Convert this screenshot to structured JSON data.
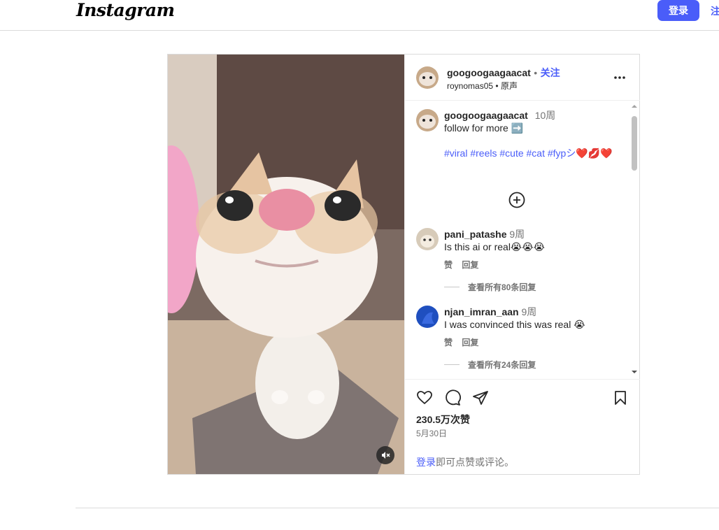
{
  "topbar": {
    "logo": "Instagram",
    "login_label": "登录",
    "signup_label": "注册"
  },
  "post": {
    "author": "googoogaagaacat",
    "follow_separator": "•",
    "follow_label": "关注",
    "audio_user": "roynomas05",
    "audio_separator": "•",
    "audio_label": "原声",
    "more_icon": "more-horizontal-icon"
  },
  "caption": {
    "username": "googoogaagaacat",
    "time": "10周",
    "line1": "follow for more ➡️",
    "hashtags": "#viral #reels #cute #cat #fypシ",
    "emojis": "❤️💋❤️"
  },
  "comments": [
    {
      "username": "pani_patashe",
      "time": "9周",
      "text": "Is this ai or real😭😭😭",
      "like_label": "赞",
      "reply_label": "回复",
      "view_replies": "查看所有80条回复",
      "avatar_color": "#d7cbb9"
    },
    {
      "username": "njan_imran_aan",
      "time": "9周",
      "text": "I was convinced this was real 😭",
      "like_label": "赞",
      "reply_label": "回复",
      "view_replies": "查看所有24条回复",
      "avatar_color": "#1f4fbf"
    }
  ],
  "stats": {
    "views": "230.5万次赞",
    "date": "5月30日"
  },
  "login_prompt": {
    "link": "登录",
    "rest": "即可点赞或评论。"
  },
  "colors": {
    "accent": "#4a5df9",
    "text": "#262626",
    "muted": "#737373",
    "border": "#dbdbdb"
  }
}
